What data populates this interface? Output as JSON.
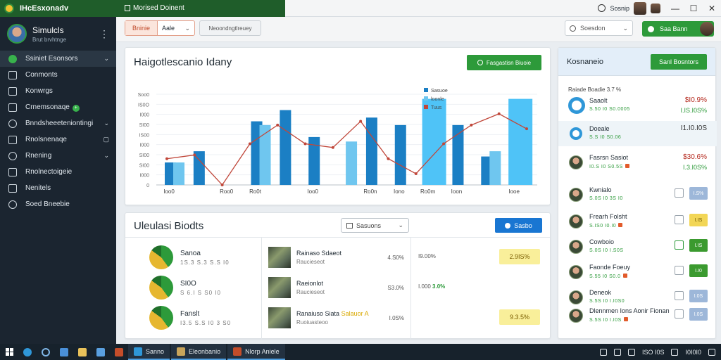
{
  "window": {
    "app_title": "IHcEsxonadv",
    "doc_title": "Morised Doinent",
    "session_label": "Sosnip",
    "controls": [
      "—",
      "☐",
      "✕"
    ]
  },
  "sidebar": {
    "profile": {
      "name": "Simulcls",
      "role": "Brut brvhtnge"
    },
    "items": [
      {
        "label": "Ssiniet Esonsors",
        "icon": "leaf-icon",
        "chevron": "⌄",
        "active": true
      },
      {
        "label": "Conmonts",
        "icon": "chart-icon",
        "chevron": ""
      },
      {
        "label": "Konwrgs",
        "icon": "analytics-icon",
        "chevron": ""
      },
      {
        "label": "Crnemsonaqe",
        "icon": "doc-icon",
        "chevron": "",
        "badge": "+"
      },
      {
        "label": "Bnndsheeeteniontingi",
        "icon": "globe-icon",
        "chevron": "⌄"
      },
      {
        "label": "Rnolsnenaqe",
        "icon": "edit-icon",
        "chevron": "▢"
      },
      {
        "label": "Rnening",
        "icon": "clock-icon",
        "chevron": "⌄"
      },
      {
        "label": "Rnolnectoigeie",
        "icon": "folder-icon",
        "chevron": ""
      },
      {
        "label": "Nenitels",
        "icon": "book-icon",
        "chevron": ""
      },
      {
        "label": "Soed Bneebie",
        "icon": "settings-icon",
        "chevron": ""
      }
    ]
  },
  "toolbar": {
    "filter_a": "Bninie",
    "filter_b": "Aale",
    "secondary_button": "Neoondngtlreuey",
    "search_placeholder": "Soesdon",
    "green_button": "Saa Bann"
  },
  "chart_panel": {
    "title": "Haigotlescanio Idany",
    "button": "Fasgastisn Biuoie"
  },
  "chart_data": {
    "type": "bar",
    "categories": [
      "Ioo0",
      "",
      "Roo0",
      "Ro0t",
      "",
      "Ioo0",
      "",
      "Ro0n",
      "Iono",
      "Ro0m",
      "Ioon",
      "",
      "Iooe"
    ],
    "y_ticks": [
      "Soo0",
      "IS0O",
      "I000",
      "SI00",
      "IS00",
      "I000",
      "SI00",
      "SI00",
      "I000",
      "0"
    ],
    "series": [
      {
        "values": [
          30,
          45,
          0,
          85,
          100,
          64,
          0,
          90,
          80,
          50,
          80,
          38,
          90
        ]
      },
      {
        "values": [
          30,
          0,
          0,
          80,
          0,
          0,
          58,
          0,
          0,
          0,
          0,
          45,
          0
        ]
      },
      {
        "values": [
          0,
          0,
          0,
          0,
          0,
          0,
          0,
          0,
          0,
          115,
          0,
          0,
          115
        ]
      }
    ],
    "line": [
      35,
      40,
      0,
      55,
      80,
      55,
      50,
      85,
      35,
      15,
      55,
      80,
      95,
      75
    ],
    "legend": [
      "Sasuoe",
      "loonle",
      "Tuus"
    ],
    "legend_position": "top-right",
    "ylim": [
      0,
      140
    ],
    "grid": true
  },
  "list_panel": {
    "title": "Uleulasi Biodts",
    "dropdown": "Sasuons",
    "button": "Sasbo",
    "stocks": [
      {
        "name": "Sanoa",
        "sub": "1S.3 S.3 S.S I0"
      },
      {
        "name": "SI0O",
        "sub": "S 6.I S S0 I0"
      },
      {
        "name": "Fanslt",
        "sub": "I3.5 S.S I0 3 S0"
      }
    ],
    "news": [
      {
        "title": "Rainaso Sdaeot",
        "highlight": "",
        "sub": "Raucieseot",
        "value": "4.S0%"
      },
      {
        "title": "Raeionlot",
        "highlight": "",
        "sub": "Raucieseot",
        "value": "S3.0%"
      },
      {
        "title": "Ranaiuso Siata",
        "highlight": "Salauor A",
        "sub": "Ruoiuasteoo",
        "value": "I.0S%"
      }
    ],
    "percents": [
      {
        "text": "I9.00%",
        "green": "",
        "badge": "2.9IS%"
      },
      {
        "text": "I.000",
        "green": "3.0%",
        "badge": ""
      },
      {
        "text": "",
        "green": "",
        "badge": "9.3.5%"
      }
    ]
  },
  "right_panel": {
    "title": "Kosnaneio",
    "button": "Sanl Bosntors",
    "subtitle": "Raiade Boadie 3.7 %",
    "rows": [
      {
        "name": "Saaolt",
        "meta": "S.50 I0 S0.0005",
        "v1": "$I0.9%",
        "v2": "I.IS.I0S%",
        "type": "ring",
        "v1dark": false
      },
      {
        "name": "Doeale",
        "meta": "S.S I0  S0.06",
        "v1": "I1.I0.I0S",
        "v2": "",
        "type": "ring-sm",
        "v1dark": true,
        "highlight": true
      },
      {
        "name": "Fasrsn Sasiot",
        "meta": "I0.S I0 S0.5S",
        "v1": "$30.6%",
        "v2": "I.3.I0S%",
        "type": "face",
        "v1dark": false
      },
      {
        "name": "Kwnialo",
        "meta": "S.0S I0 3S I0",
        "tag": "I.S%",
        "tagColor": "blue",
        "type": "face"
      },
      {
        "name": "Frearh Folsht",
        "meta": "S.IS0 I0.I0",
        "tag": "I.IS",
        "tagColor": "yellow",
        "type": "face"
      },
      {
        "name": "Cowboio",
        "meta": "S.0S I0 I.S0S",
        "tag": "I.IS",
        "tagColor": "green",
        "type": "face",
        "checked": true
      },
      {
        "name": "Faonde Foeuy",
        "meta": "S.55 I0 S0.0",
        "tag": "I.I0",
        "tagColor": "green",
        "type": "face"
      },
      {
        "name": "Deneok",
        "meta": "S.5S I0 I.I0S0",
        "tag": "I.0S",
        "tagColor": "blue",
        "type": "face"
      },
      {
        "name": "Dlennmen Ions Aonir Fionan",
        "meta": "S.5S I0 I.I0S",
        "tag": "I.0S",
        "tagColor": "blue",
        "type": "face"
      }
    ]
  },
  "taskbar": {
    "apps": [
      {
        "label": "Sanno",
        "color": "#2f97d8"
      },
      {
        "label": "Eleonbanio",
        "color": "#c8a45a"
      },
      {
        "label": "Nlorp Aniele",
        "color": "#c44d2a"
      }
    ],
    "pinned": [
      "edge-icon",
      "circle-icon",
      "mail-icon",
      "folder-icon",
      "store-icon",
      "photos-icon",
      "app-icon"
    ],
    "clock": "ISO I0S",
    "date": "I0I0I0"
  }
}
